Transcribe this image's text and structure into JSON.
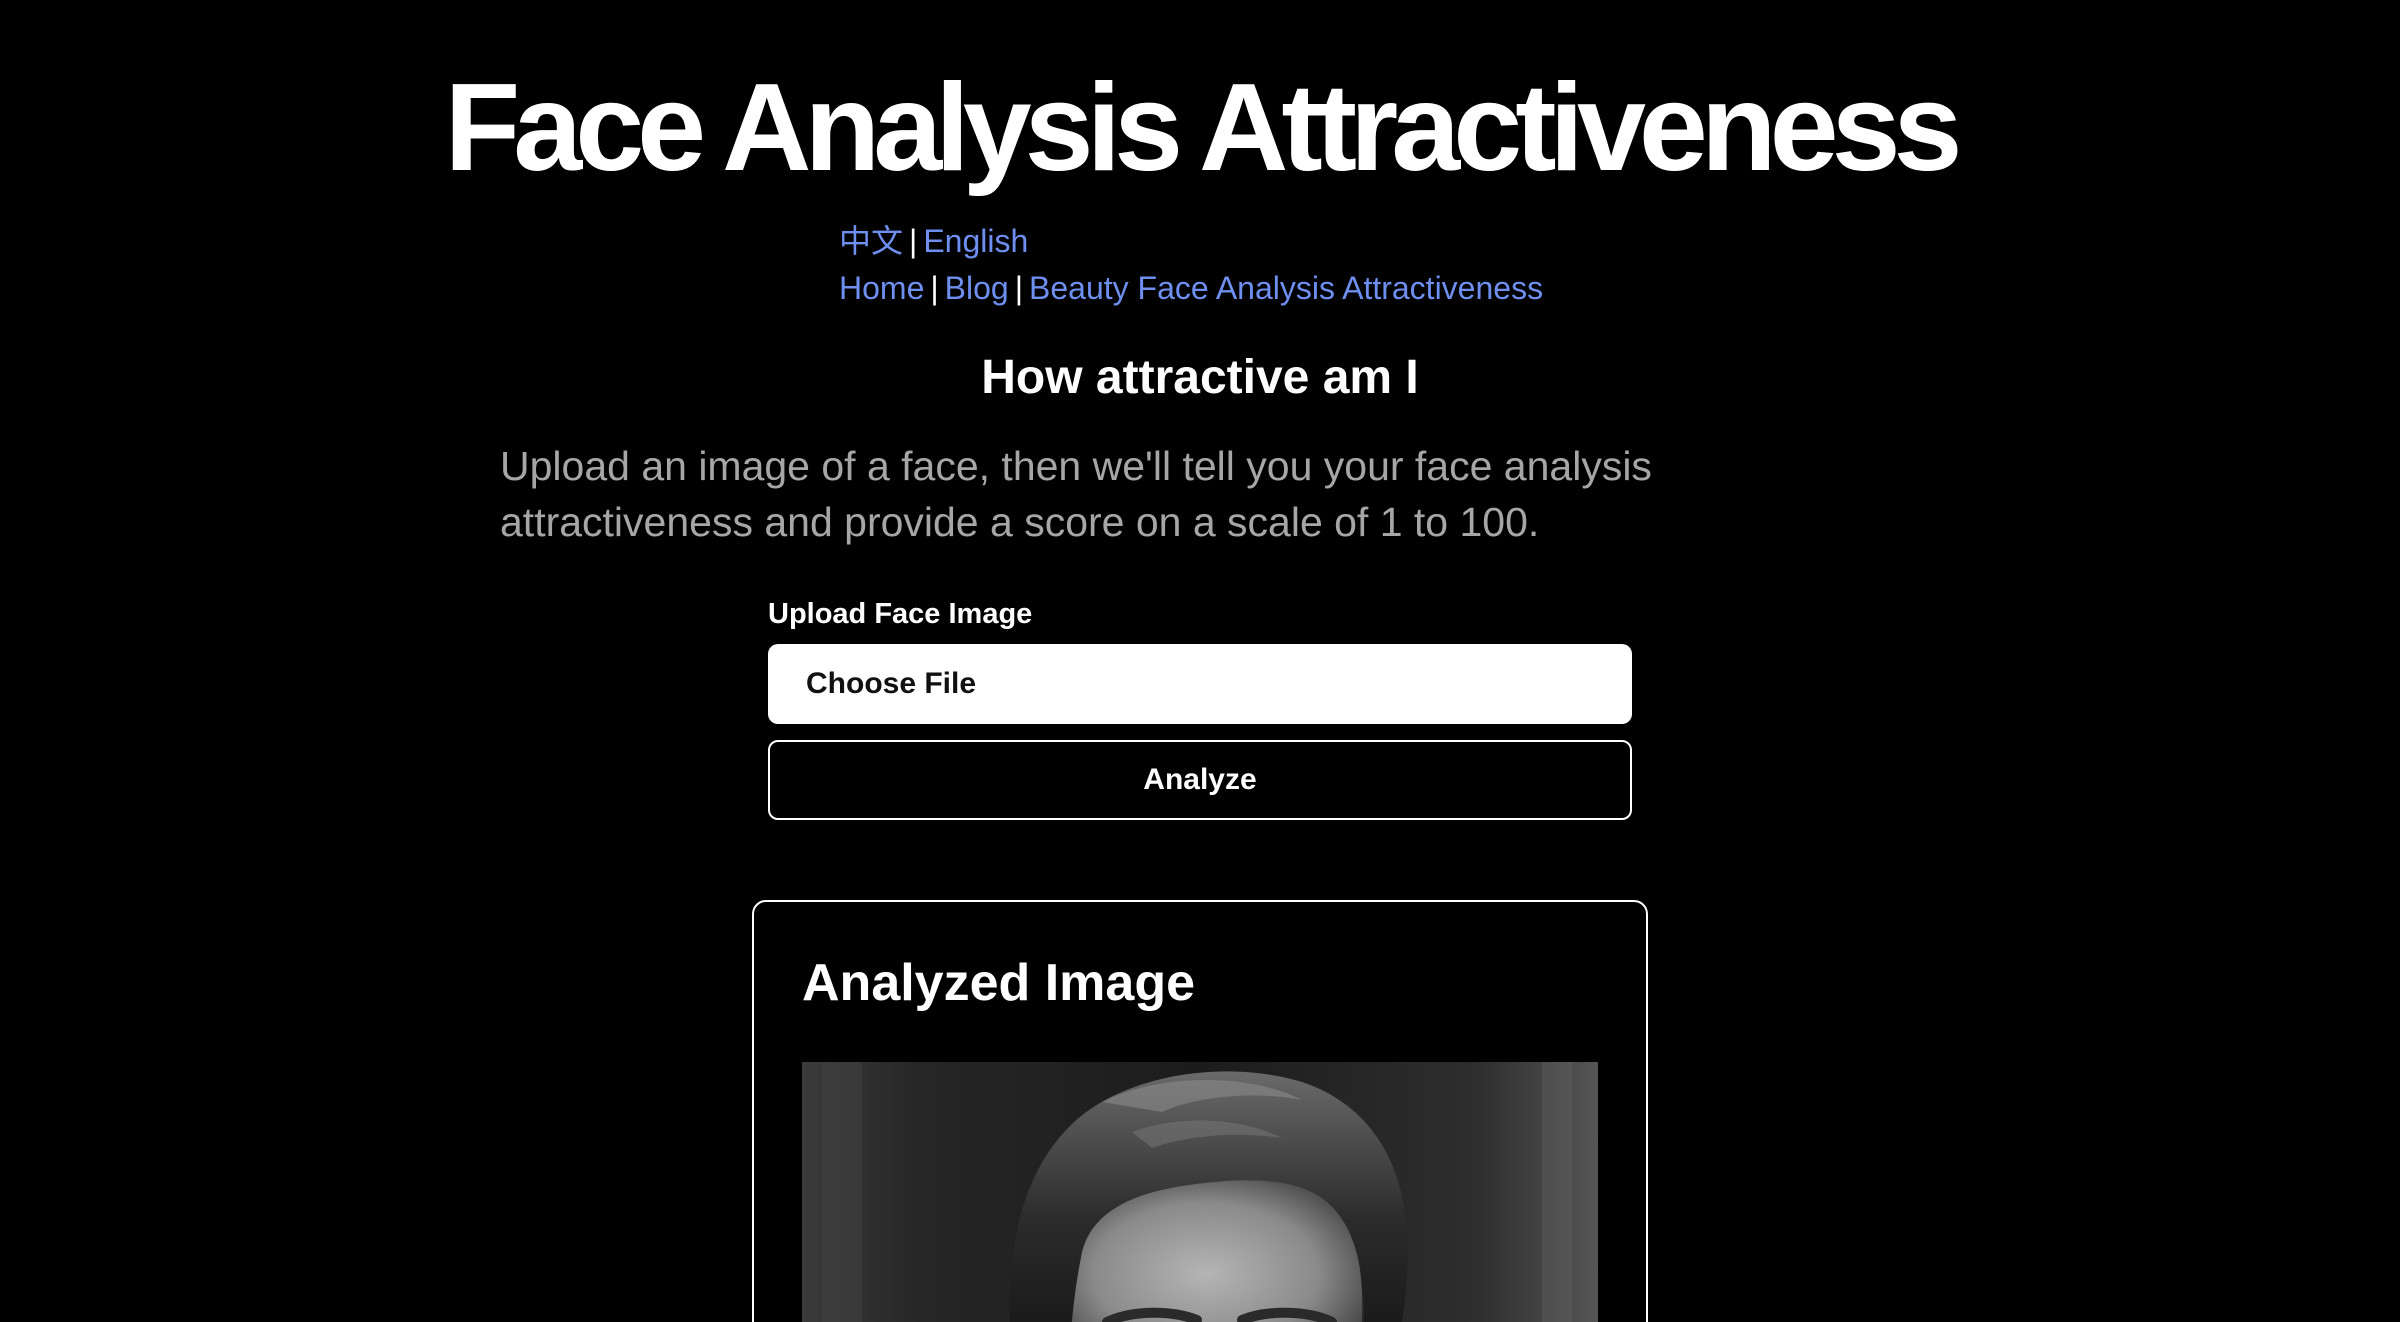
{
  "header": {
    "title": "Face Analysis Attractiveness"
  },
  "language_nav": {
    "chinese": "中文",
    "separator": "|",
    "english": "English"
  },
  "site_nav": {
    "home": "Home",
    "blog": "Blog",
    "beauty": "Beauty Face Analysis Attractiveness",
    "separator": "|"
  },
  "main": {
    "subtitle": "How attractive am I",
    "description": "Upload an image of a face, then we'll tell you your face analysis attractiveness and provide a score on a scale of 1 to 100."
  },
  "upload": {
    "label": "Upload Face Image",
    "file_button": "Choose File",
    "analyze_button": "Analyze"
  },
  "result": {
    "title": "Analyzed Image"
  },
  "colors": {
    "background": "#000000",
    "link": "#6e8ff0",
    "description_text": "#a6a6a6"
  }
}
